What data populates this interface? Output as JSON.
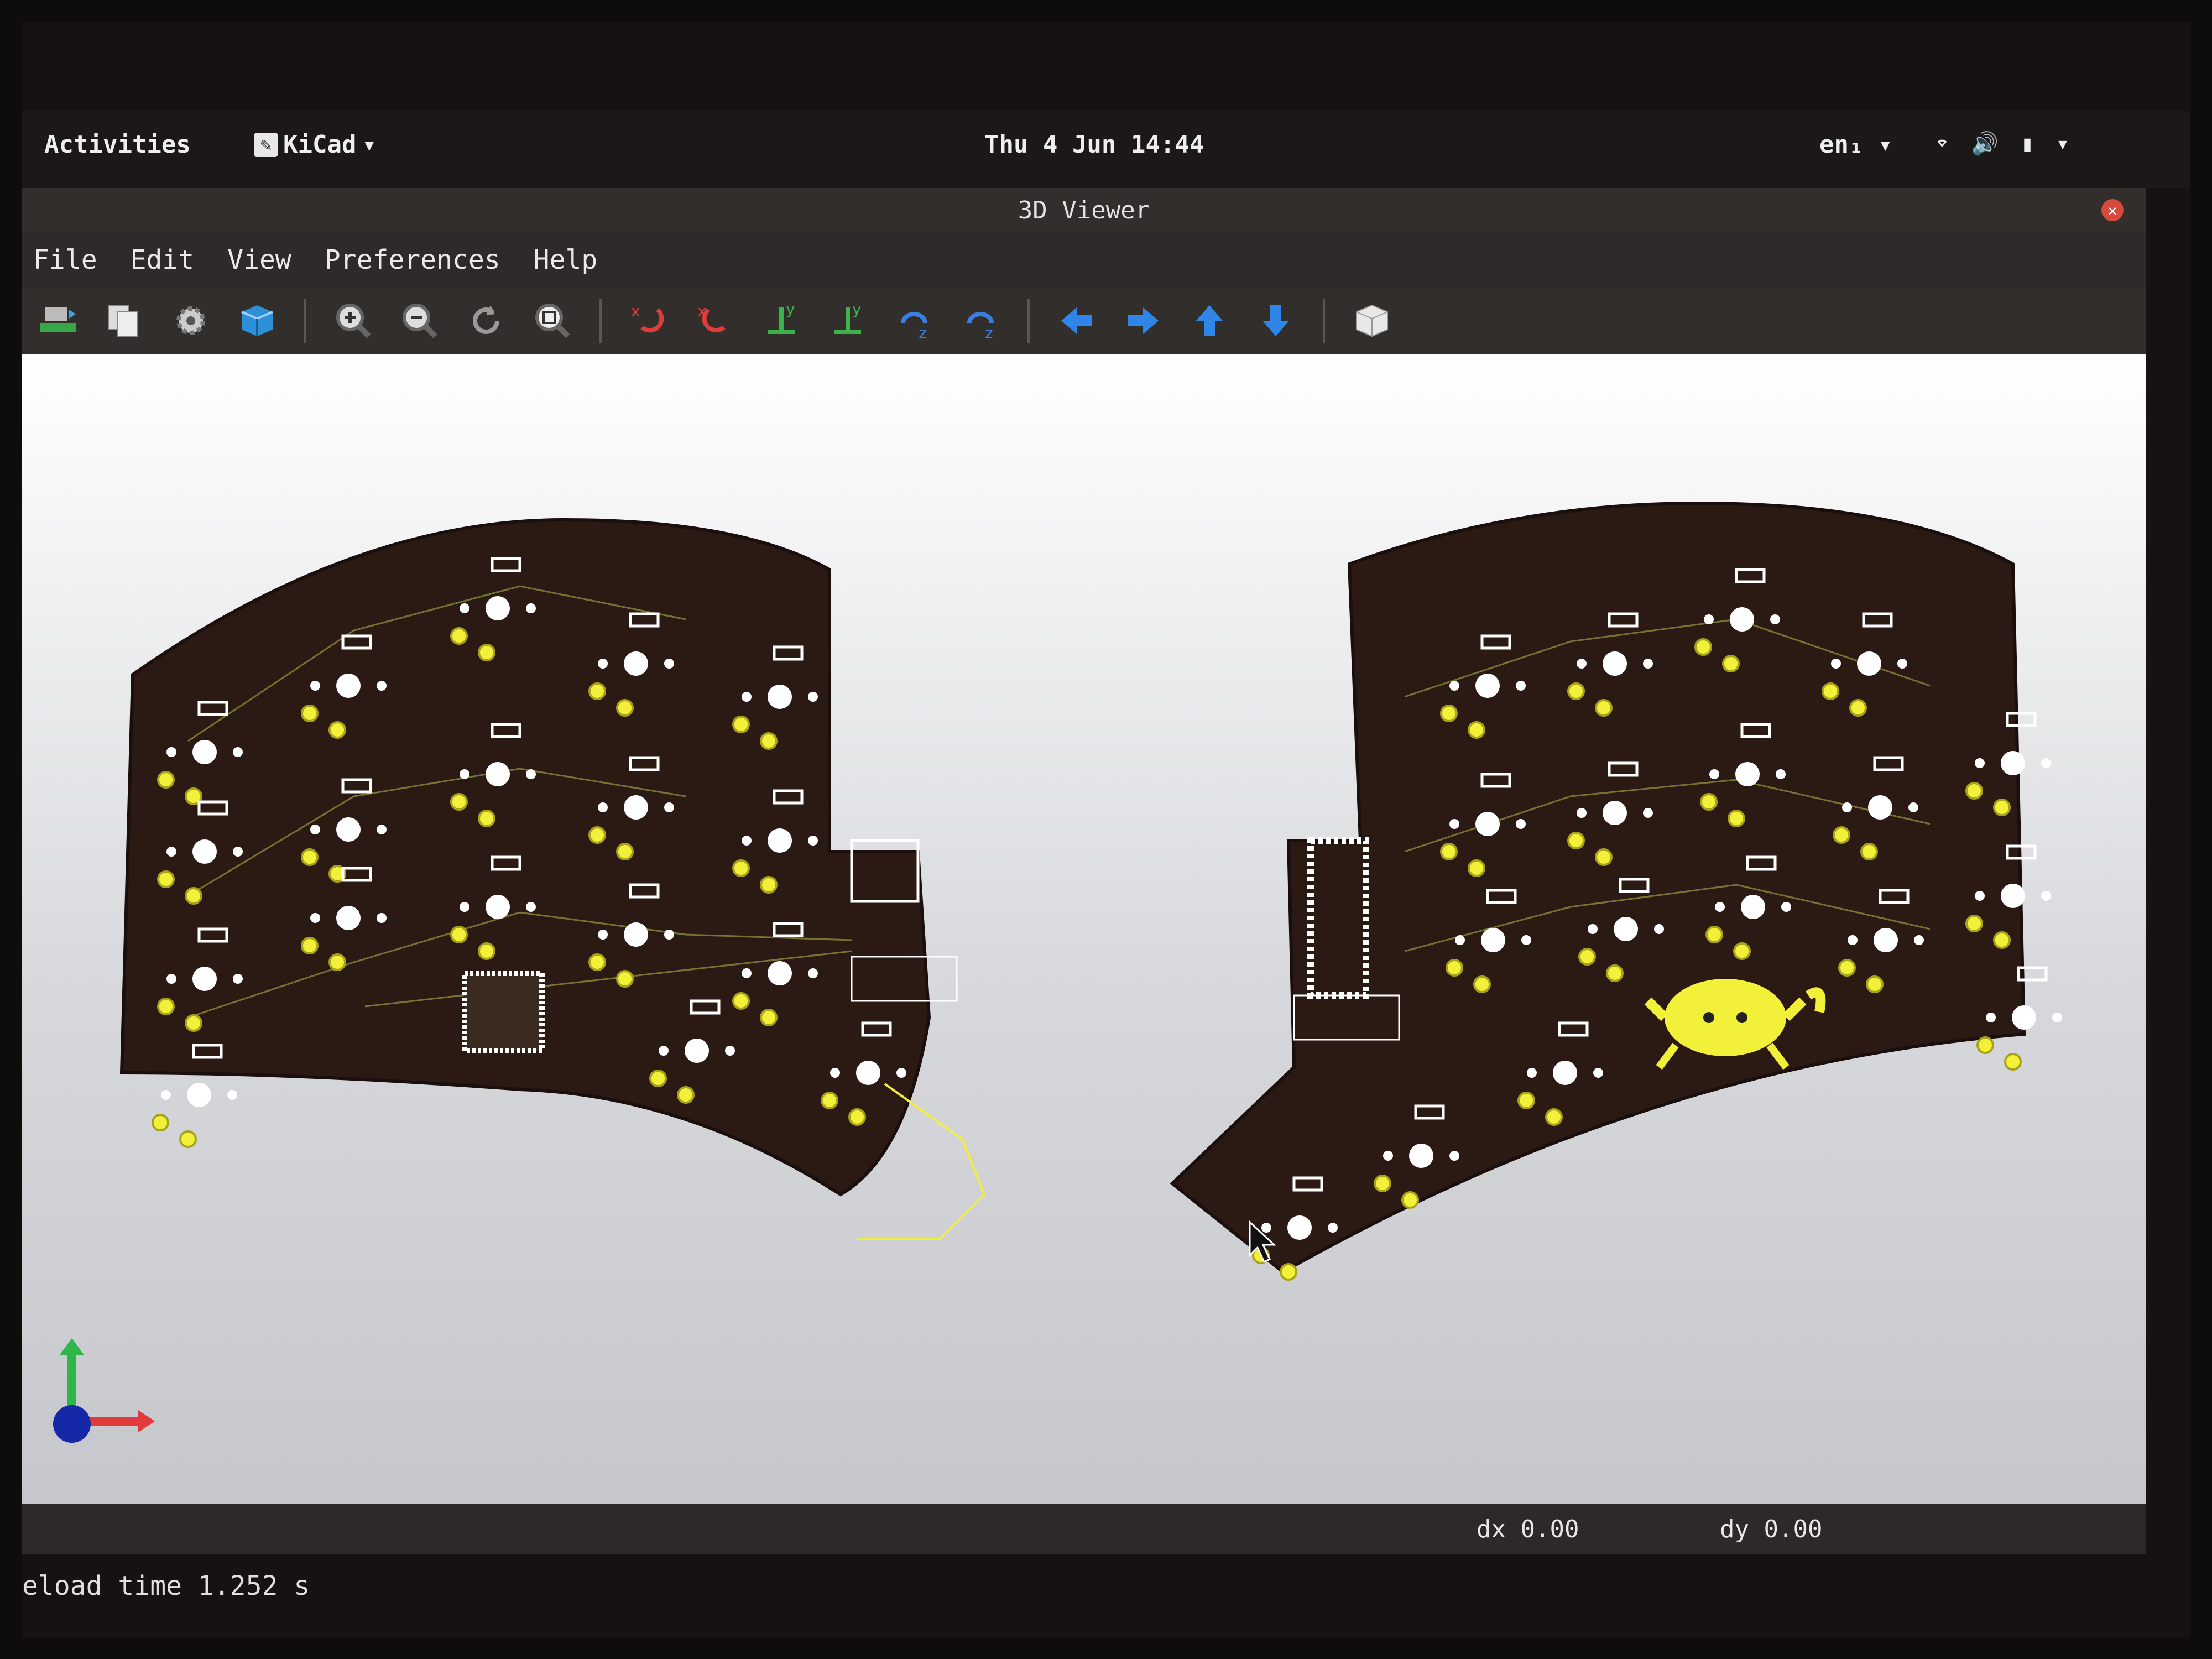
{
  "topbar": {
    "activities": "Activities",
    "app_name": "KiCad",
    "clock": "Thu 4 Jun 14:44",
    "language": "en₁"
  },
  "window": {
    "title": "3D Viewer",
    "menu": [
      "File",
      "Edit",
      "View",
      "Preferences",
      "Help"
    ]
  },
  "toolbar": {
    "buttons": [
      "reload-board",
      "copy-image",
      "render-settings",
      "raytracing",
      "zoom-in",
      "zoom-out",
      "redraw",
      "zoom-fit",
      "rotate-x-cw",
      "rotate-x-ccw",
      "rotate-y-cw",
      "rotate-y-ccw",
      "rotate-z-cw",
      "rotate-z-ccw",
      "pan-left",
      "pan-right",
      "pan-up",
      "pan-down",
      "view-orthogonal"
    ]
  },
  "status": {
    "dx": "dx 0.00",
    "dy": "dy 0.00",
    "reload": "eload time 1.252 s"
  },
  "colors": {
    "board": "#2b1914",
    "pads": "#f3f03a",
    "silkscreen": "#ffffff",
    "background_top": "#ffffff",
    "background_bottom": "#c6c7cc"
  }
}
